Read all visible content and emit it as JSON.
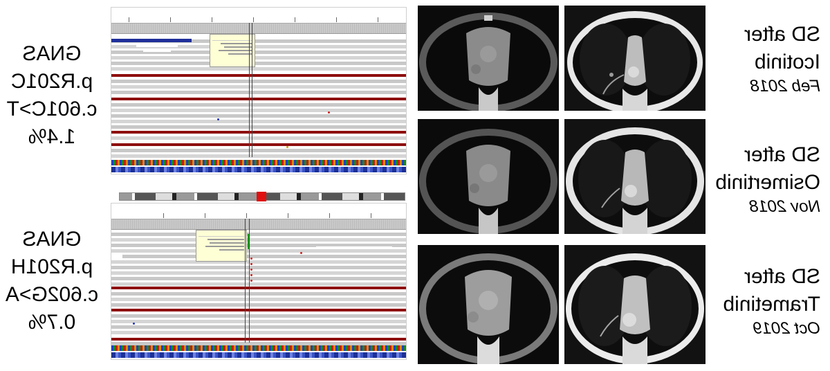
{
  "left_labels": [
    {
      "gene": "GNAS",
      "protein": "p.R201C",
      "cdna": "c.601C>T",
      "vaf": "1.4%"
    },
    {
      "gene": "GNAS",
      "protein": "p.R201H",
      "cdna": "c.602G>A",
      "vaf": "0.7%"
    }
  ],
  "right_labels": [
    {
      "line1": "SD after",
      "drug": "Icotinib",
      "date": "Feb 2018"
    },
    {
      "line1": "SD after",
      "drug": "Osimertinib",
      "date": "Nov 2018"
    },
    {
      "line1": "SD after",
      "drug": "Trametinib",
      "date": "Oct 2019"
    }
  ],
  "colors": {
    "read_gray": "#c8c8c8",
    "mismatch_red": "#8e0c0c",
    "popup_yellow": "#ffffd6",
    "gene_blue": "#1c3096"
  },
  "icons": [
    "igv-alignment-view",
    "ct-mediastinal-window",
    "ct-lung-window"
  ]
}
